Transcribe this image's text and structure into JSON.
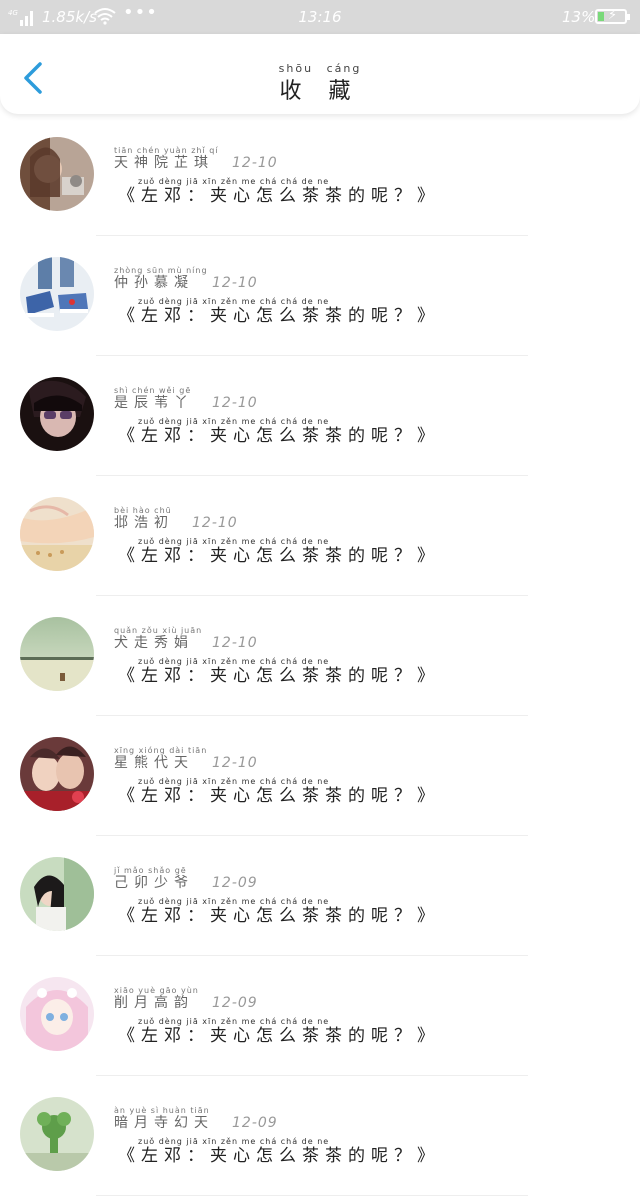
{
  "status_bar": {
    "network": "4G",
    "speed": "1.85k/s",
    "dots": "•••",
    "time": "13:16",
    "battery_percent": "13%",
    "battery_level": 0.13,
    "text_color": "#ffffff",
    "charging_color": "#7ad97a"
  },
  "header": {
    "back_icon": "chevron-left-icon",
    "back_color": "#2d9cdb",
    "title_pinyin": "shōu cáng",
    "title": "收 藏"
  },
  "items": [
    {
      "name_pinyin": "tiān chén yuàn zhǐ qí",
      "name": "天神院芷琪",
      "date": "12-10",
      "msg_pinyin": "zuǒ dèng   jiā xīn zěn me chá chá de ne",
      "message": "《左邓：夹心怎么茶茶的呢？》",
      "avatar": "avatar-1"
    },
    {
      "name_pinyin": "zhòng sūn mù níng",
      "name": "仲孙慕凝",
      "date": "12-10",
      "msg_pinyin": "zuǒ dèng   jiā xīn zěn me chá chá de ne",
      "message": "《左邓：夹心怎么茶茶的呢？》",
      "avatar": "avatar-2"
    },
    {
      "name_pinyin": "shì chén wěi gē",
      "name": "是辰苇丫",
      "date": "12-10",
      "msg_pinyin": "zuǒ dèng   jiā xīn zěn me chá chá de ne",
      "message": "《左邓：夹心怎么茶茶的呢？》",
      "avatar": "avatar-3"
    },
    {
      "name_pinyin": "bèi hào chū",
      "name": "邶浩初",
      "date": "12-10",
      "msg_pinyin": "zuǒ dèng   jiā xīn zěn me chá chá de ne",
      "message": "《左邓：夹心怎么茶茶的呢？》",
      "avatar": "avatar-4"
    },
    {
      "name_pinyin": "quǎn zǒu xiù juān",
      "name": "犬走秀娟",
      "date": "12-10",
      "msg_pinyin": "zuǒ dèng   jiā xīn zěn me chá chá de ne",
      "message": "《左邓：夹心怎么茶茶的呢？》",
      "avatar": "avatar-5"
    },
    {
      "name_pinyin": "xīng xióng dài tiān",
      "name": "星熊代天",
      "date": "12-10",
      "msg_pinyin": "zuǒ dèng   jiā xīn zěn me chá chá de ne",
      "message": "《左邓：夹心怎么茶茶的呢？》",
      "avatar": "avatar-6"
    },
    {
      "name_pinyin": "jǐ mǎo shǎo gē",
      "name": "己卯少爷",
      "date": "12-09",
      "msg_pinyin": "zuǒ dèng   jiā xīn zěn me chá chá de ne",
      "message": "《左邓：夹心怎么茶茶的呢？》",
      "avatar": "avatar-7"
    },
    {
      "name_pinyin": "xiāo yuè gāo yùn",
      "name": "削月高韵",
      "date": "12-09",
      "msg_pinyin": "zuǒ dèng   jiā xīn zěn me chá chá de ne",
      "message": "《左邓：夹心怎么茶茶的呢？》",
      "avatar": "avatar-8"
    },
    {
      "name_pinyin": "àn yuè sì huàn tiān",
      "name": "暗月寺幻天",
      "date": "12-09",
      "msg_pinyin": "zuǒ dèng   jiā xīn zěn me chá chá de ne",
      "message": "《左邓：夹心怎么茶茶的呢？》",
      "avatar": "avatar-9"
    }
  ]
}
